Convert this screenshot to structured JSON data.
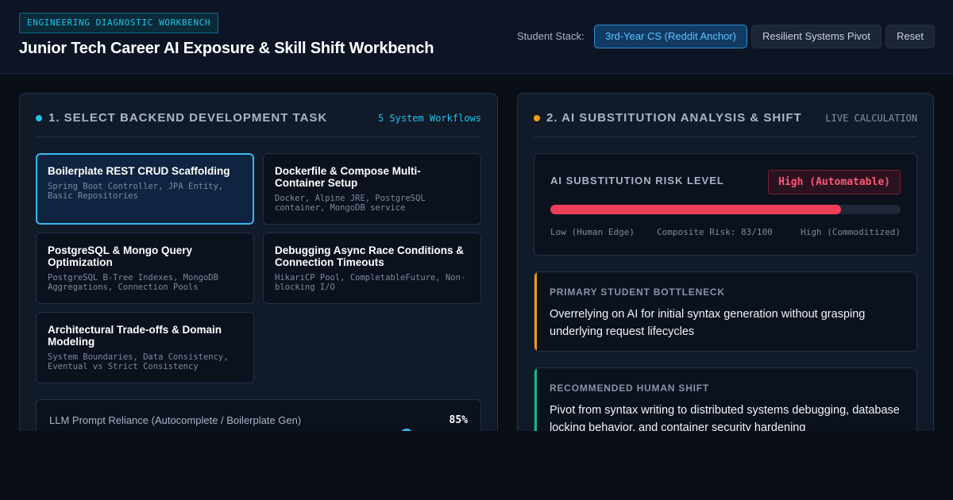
{
  "header": {
    "badge": "ENGINEERING DIAGNOSTIC WORKBENCH",
    "title": "Junior Tech Career AI Exposure & Skill Shift Workbench",
    "stack_label": "Student Stack:",
    "buttons": [
      "3rd-Year CS (Reddit Anchor)",
      "Resilient Systems Pivot",
      "Reset"
    ],
    "active_button": "3rd-Year CS (Reddit Anchor)"
  },
  "left_panel": {
    "title": "1. SELECT BACKEND DEVELOPMENT TASK",
    "meta": "5 System Workflows",
    "tasks": [
      {
        "title": "Boilerplate REST CRUD Scaffolding",
        "sub": "Spring Boot Controller, JPA Entity, Basic Repositories",
        "selected": true
      },
      {
        "title": "Dockerfile & Compose Multi-Container Setup",
        "sub": "Docker, Alpine JRE, PostgreSQL container, MongoDB service",
        "selected": false
      },
      {
        "title": "PostgreSQL & Mongo Query Optimization",
        "sub": "PostgreSQL B-Tree Indexes, MongoDB Aggregations, Connection Pools",
        "selected": false
      },
      {
        "title": "Debugging Async Race Conditions & Connection Timeouts",
        "sub": "HikariCP Pool, CompletableFuture, Non-blocking I/O",
        "selected": false
      },
      {
        "title": "Architectural Trade-offs & Domain Modeling",
        "sub": "System Boundaries, Data Consistency, Eventual vs Strict Consistency",
        "selected": false
      }
    ],
    "slider": {
      "label": "LLM Prompt Reliance (Autocomplete / Boilerplate Gen)",
      "value_text": "85%",
      "value": 0.85
    }
  },
  "right_panel": {
    "title": "2. AI SUBSTITUTION ANALYSIS & SHIFT",
    "meta": "LIVE CALCULATION",
    "risk": {
      "label": "AI SUBSTITUTION RISK LEVEL",
      "badge": "High (Automatable)",
      "score": 83,
      "scale_low": "Low (Human Edge)",
      "scale_mid": "Composite Risk: 83/100",
      "scale_high": "High (Commoditized)"
    },
    "bottleneck": {
      "title": "PRIMARY STUDENT BOTTLENECK",
      "text": "Overrelying on AI for initial syntax generation without grasping underlying request lifecycles"
    },
    "shift": {
      "title": "RECOMMENDED HUMAN SHIFT",
      "text": "Pivot from syntax writing to distributed systems debugging, database locking behavior, and container security hardening"
    }
  },
  "colors": {
    "accent_cyan": "#22c3e6",
    "accent_amber": "#f59e0b",
    "risk_red": "#ef3e5a",
    "shift_green": "#10b981"
  }
}
